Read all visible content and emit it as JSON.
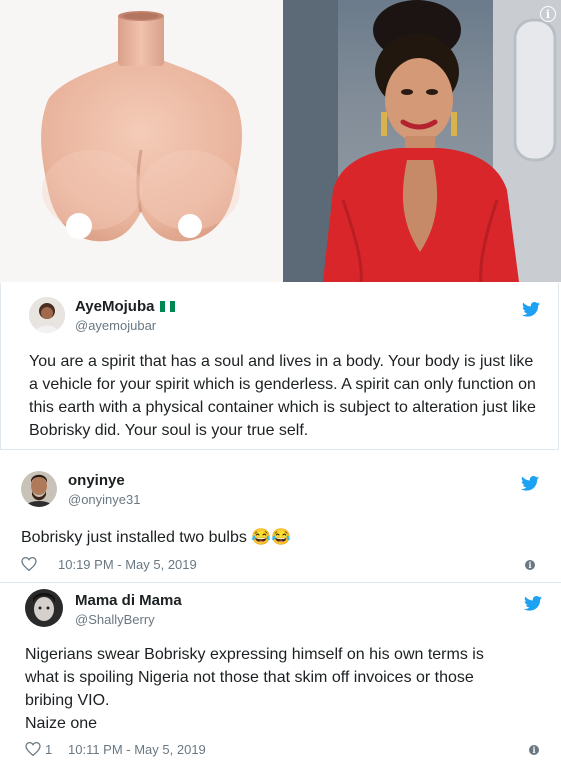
{
  "colors": {
    "twitter_blue": "#1da1f2",
    "text": "#1c2022",
    "muted": "#697882",
    "dress_red": "#d8262a",
    "flag_green": "#008751"
  },
  "images": {
    "left_icon": "silicone-breastplate-photo",
    "right_icon": "woman-in-red-dress-photo",
    "info_glyph": "i"
  },
  "tweets": [
    {
      "name": "AyeMojuba",
      "handle": "@ayemojubar",
      "body": "You are a spirit that has a soul and lives in a body. Your body is just like a vehicle for your spirit which is genderless. A spirit can only function on this earth with a physical container which is subject to alteration just like Bobrisky did. Your soul is your true self.",
      "icon": "nigeria-flag-icon"
    },
    {
      "name": "onyinye",
      "handle": "@onyinye31",
      "body": "Bobrisky just installed two bulbs 😂😂",
      "likes": "",
      "timestamp": "10:19 PM - May 5, 2019"
    },
    {
      "name": "Mama di Mama",
      "handle": "@ShallyBerry",
      "body_lines": [
        "Nigerians swear Bobrisky expressing himself on his own terms is",
        "what is spoiling Nigeria not those that skim off  invoices or those",
        "bribing VIO.",
        "Naize one"
      ],
      "likes": "1",
      "timestamp": "10:11 PM - May 5, 2019"
    }
  ]
}
